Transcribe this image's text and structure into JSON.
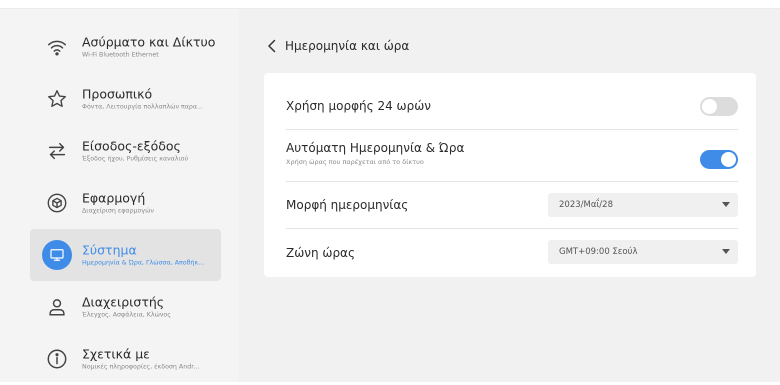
{
  "sidebar": {
    "items": [
      {
        "title": "Ασύρματο και Δίκτυο",
        "subtitle": "Wi-Fi Bluetooth Ethernet",
        "icon": "wifi-icon"
      },
      {
        "title": "Προσωπικό",
        "subtitle": "Φόντα, Λειτουργία πολλαπλών παρα...",
        "icon": "star-icon"
      },
      {
        "title": "Είσοδος-εξόδος",
        "subtitle": "Έξοδος ήχου, Ρυθμίσεις καναλιού",
        "icon": "swap-arrows-icon"
      },
      {
        "title": "Εφαρμογή",
        "subtitle": "Διαχείριση εφαρμογών",
        "icon": "cube-icon"
      },
      {
        "title": "Σύστημα",
        "subtitle": "Ημερομηνία & Ώρα, Γλώσσα, Αποθήκ...",
        "icon": "monitor-icon"
      },
      {
        "title": "Διαχειριστής",
        "subtitle": "Έλεγχος, Ασφάλεια, Κλώνος",
        "icon": "user-icon"
      },
      {
        "title": "Σχετικά με",
        "subtitle": "Νομικές πληροφορίες, έκδοση Andr...",
        "icon": "info-icon"
      }
    ],
    "active_index": 4
  },
  "header": {
    "title": "Ημερομηνία και ώρα"
  },
  "settings": {
    "format24": {
      "label": "Χρήση μορφής 24 ωρών",
      "enabled": false
    },
    "auto_datetime": {
      "label": "Αυτόματη Ημερομηνία & Ώρα",
      "sublabel": "Χρήση ώρας που παρέχεται από το δίκτυο",
      "enabled": true
    },
    "date_format": {
      "label": "Μορφή ημερομηνίας",
      "value": "2023/Μαΐ/28"
    },
    "timezone": {
      "label": "Ζώνη ώρας",
      "value": "GMT+09:00 Σεούλ"
    }
  },
  "colors": {
    "accent": "#3f8ce8",
    "sidebar_bg": "#f4f4f4",
    "main_bg": "#f1f1f1"
  }
}
